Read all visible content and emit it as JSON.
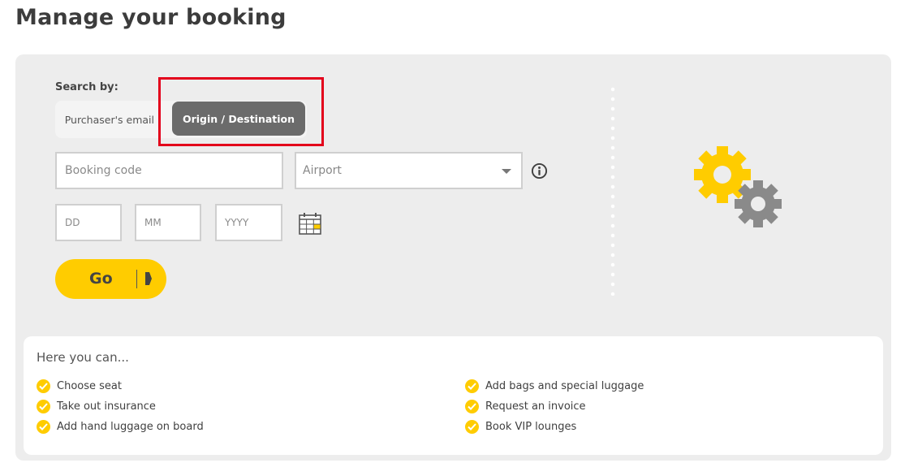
{
  "page": {
    "title": "Manage your booking"
  },
  "search": {
    "label": "Search by:",
    "options": [
      "Purchaser's email",
      "Origin / Destination"
    ],
    "selected": "Origin / Destination"
  },
  "form": {
    "booking_code_placeholder": "Booking code",
    "airport_placeholder": "Airport",
    "day_placeholder": "DD",
    "month_placeholder": "MM",
    "year_placeholder": "YYYY",
    "go_label": "Go"
  },
  "features": {
    "title": "Here you can...",
    "left": [
      "Choose seat",
      "Take out insurance",
      "Add hand luggage on board"
    ],
    "right": [
      "Add bags and special luggage",
      "Request an invoice",
      "Book VIP lounges"
    ]
  },
  "colors": {
    "accent": "#ffcc00",
    "selected_toggle": "#6b6b6b",
    "panel_bg": "#ededed",
    "highlight": "#e3001b"
  },
  "icons": [
    "info-icon",
    "calendar-icon",
    "gears-icon",
    "check-icon",
    "play-arrow-icon"
  ]
}
